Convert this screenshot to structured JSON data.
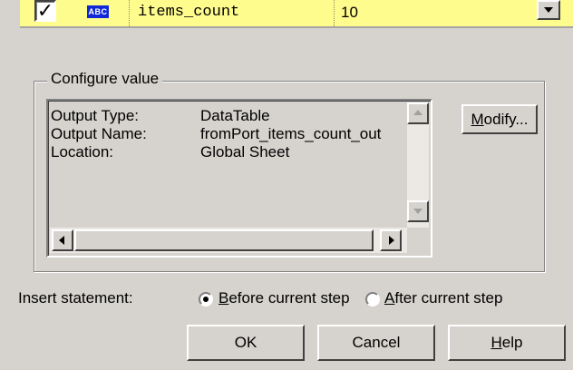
{
  "grid_row": {
    "checked": true,
    "type_icon_label": "ABC",
    "name": "items_count",
    "value": "10"
  },
  "configure": {
    "legend": "Configure value",
    "items": [
      {
        "label": "Output Type:",
        "value": "DataTable"
      },
      {
        "label": "Output Name:",
        "value": "fromPort_items_count_out"
      },
      {
        "label": "Location:",
        "value": "Global Sheet"
      }
    ],
    "modify_button": {
      "mnemonic": "M",
      "rest": "odify..."
    }
  },
  "insert": {
    "label": "Insert statement:",
    "before": {
      "mnemonic": "B",
      "rest": "efore current step",
      "checked": true
    },
    "after": {
      "mnemonic": "A",
      "rest": "fter current step",
      "checked": false
    }
  },
  "buttons": {
    "ok": "OK",
    "cancel": "Cancel",
    "help": {
      "mnemonic": "H",
      "rest": "elp"
    }
  }
}
